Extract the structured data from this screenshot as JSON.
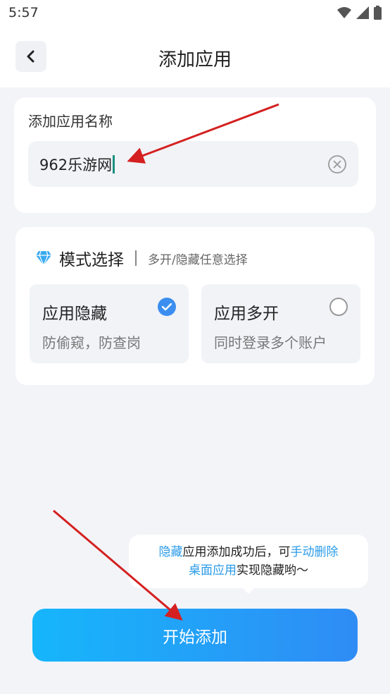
{
  "status_bar": {
    "time": "5:57"
  },
  "header": {
    "title": "添加应用"
  },
  "name_card": {
    "label": "添加应用名称",
    "input_value": "962乐游网"
  },
  "mode_card": {
    "title": "模式选择",
    "subtitle": "多开/隐藏任意选择",
    "options": [
      {
        "title": "应用隐藏",
        "desc": "防偷窥，防查岗",
        "selected": true
      },
      {
        "title": "应用多开",
        "desc": "同时登录多个账户",
        "selected": false
      }
    ]
  },
  "tooltip": {
    "line1_hl1": "隐藏",
    "line1_mid": "应用添加成功后，可",
    "line1_hl2": "手动删除",
    "line2_hl": "桌面应用",
    "line2_rest": "实现隐藏哟～"
  },
  "start_button": {
    "label": "开始添加"
  },
  "colors": {
    "accent": "#2f8cf5",
    "check_blue": "#3b8ef0",
    "highlight": "#2a9be8",
    "annotation_arrow": "#d42020"
  },
  "icons": [
    "wifi-icon",
    "signal-icon",
    "battery-icon",
    "back-arrow-icon",
    "clear-icon",
    "diamond-icon",
    "check-icon"
  ]
}
